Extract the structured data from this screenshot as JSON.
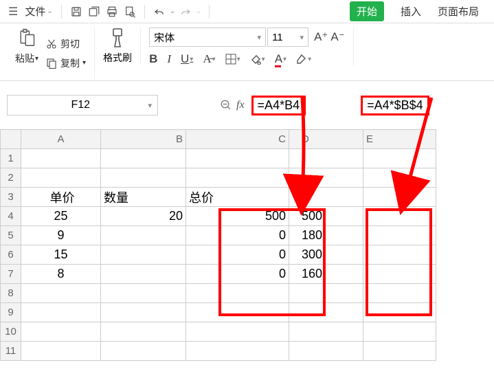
{
  "topbar": {
    "file_label": "文件",
    "tabs": {
      "start": "开始",
      "insert": "插入",
      "layout": "页面布局"
    }
  },
  "ribbon": {
    "paste": "粘贴",
    "cut": "剪切",
    "copy": "复制",
    "format_painter": "格式刷",
    "font_name": "宋体",
    "font_size": "11",
    "bold": "B",
    "italic": "I",
    "underline": "U",
    "A_plus": "A⁺",
    "A_minus": "A⁻",
    "A_color": "A"
  },
  "namebox": {
    "cell": "F12"
  },
  "formulas": {
    "f_c": "=A4*B4",
    "f_e": "=A4*$B$4"
  },
  "sheet": {
    "cols": [
      "A",
      "B",
      "C",
      "D",
      "E"
    ],
    "rows": [
      "1",
      "2",
      "3",
      "4",
      "5",
      "6",
      "7",
      "8",
      "9",
      "10",
      "11"
    ],
    "headers": {
      "a3": "单价",
      "b3": "数量",
      "c3": "总价"
    },
    "data": {
      "a": [
        "25",
        "9",
        "15",
        "8"
      ],
      "b4": "20",
      "c": [
        "500",
        "0",
        "0",
        "0"
      ],
      "d": [
        "500",
        "180",
        "300",
        "160"
      ]
    }
  }
}
